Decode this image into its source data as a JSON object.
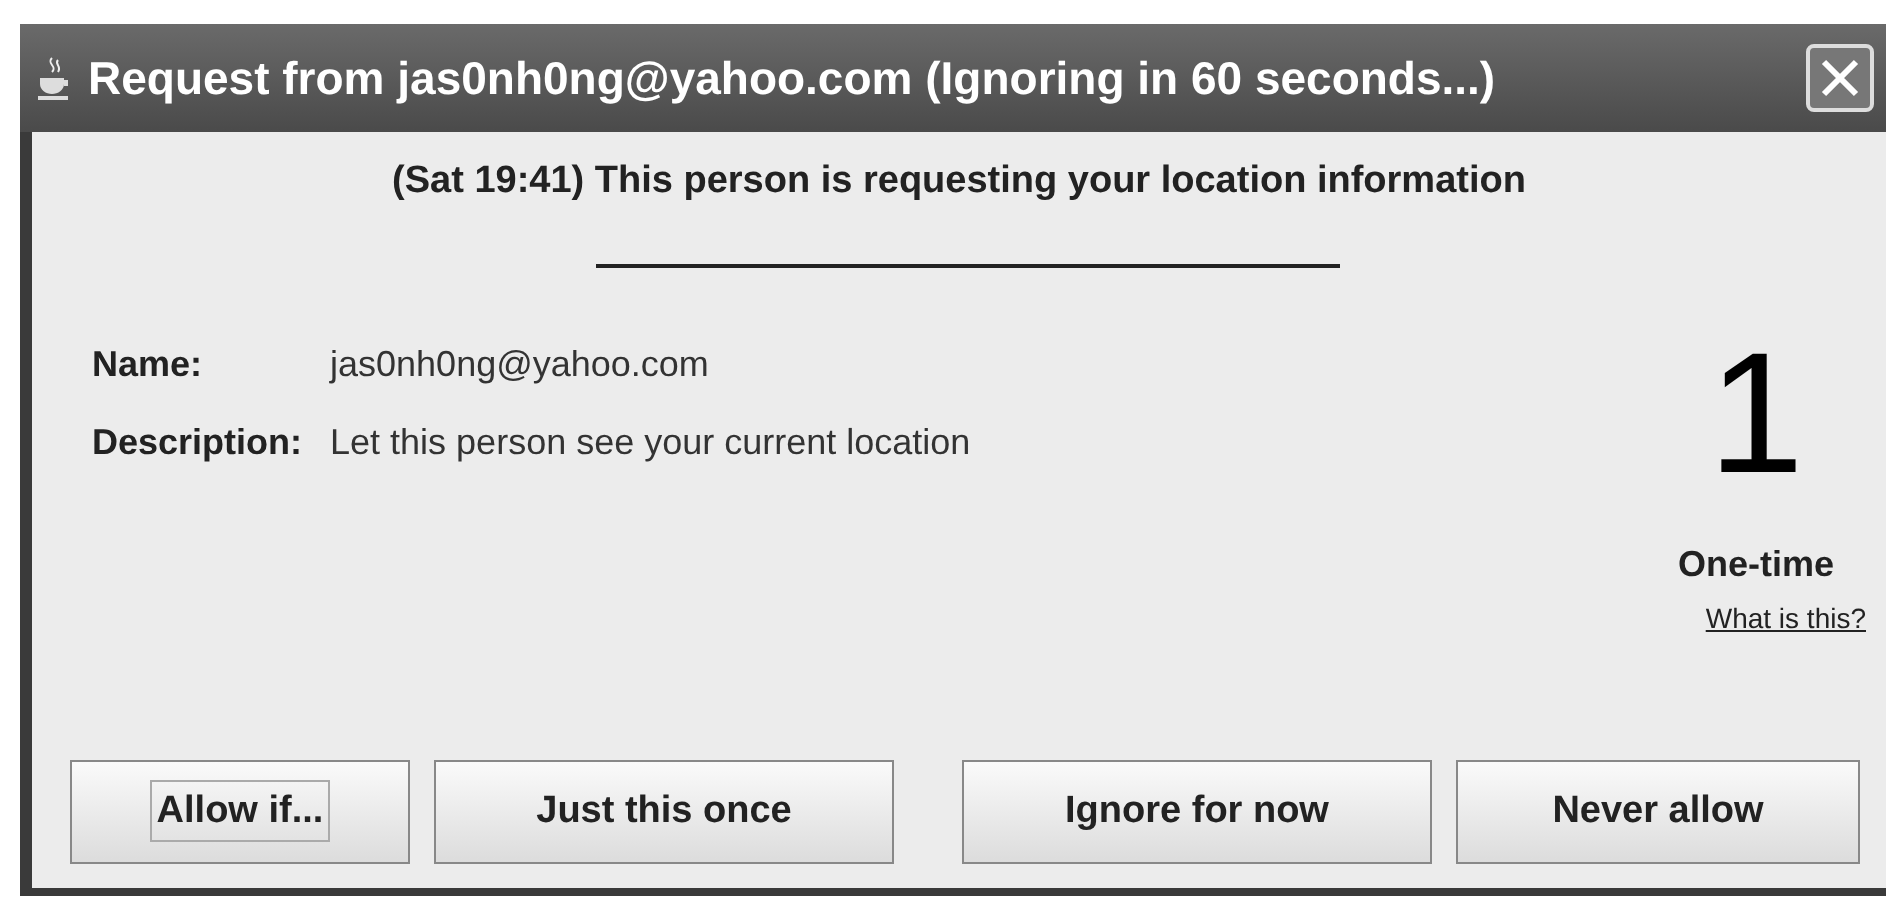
{
  "window": {
    "title": "Request from jas0nh0ng@yahoo.com (Ignoring in 60 seconds...)"
  },
  "heading": "(Sat 19:41) This person is requesting your location information",
  "fields": [
    {
      "label": "Name:",
      "value": "jas0nh0ng@yahoo.com"
    },
    {
      "label": "Description:",
      "value": "Let this person see your current location"
    }
  ],
  "frequency": {
    "number": "1",
    "label": "One-time",
    "link": "What is this?"
  },
  "buttons": [
    {
      "label": "Allow if...",
      "focused": true
    },
    {
      "label": "Just this once",
      "focused": false
    },
    {
      "label": "Ignore for now",
      "focused": false
    },
    {
      "label": "Never allow",
      "focused": false
    }
  ]
}
